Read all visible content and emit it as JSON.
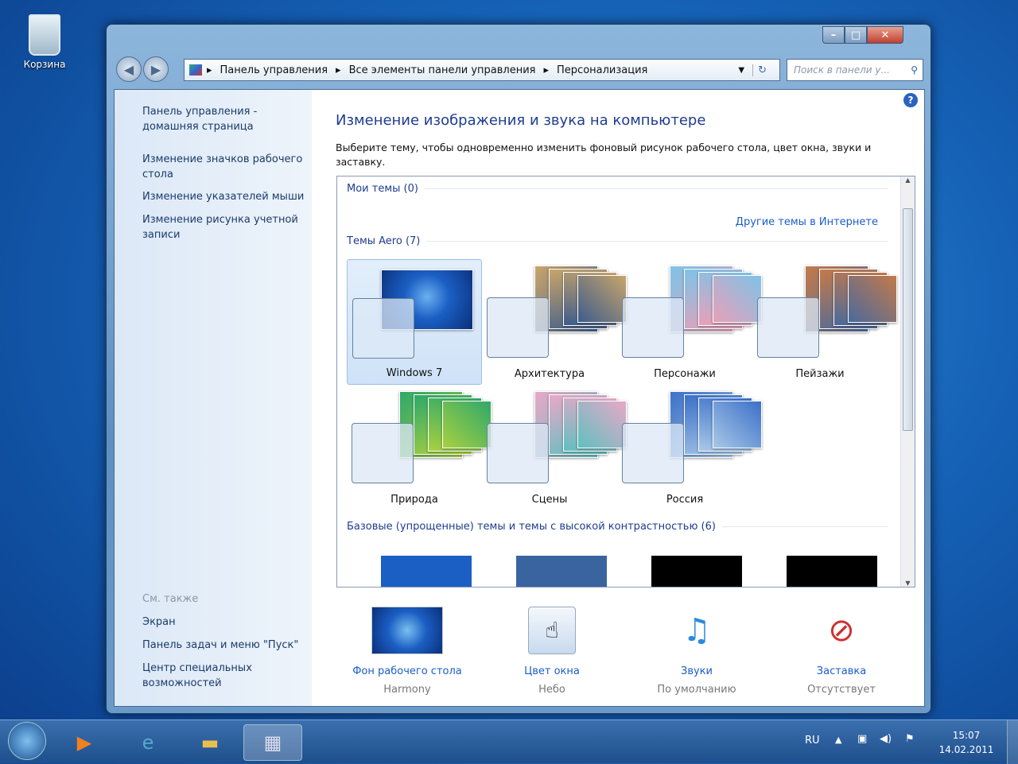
{
  "desktop": {
    "recycle_bin": "Корзина"
  },
  "window": {
    "controls": {
      "minimize": "–",
      "maximize": "□",
      "close": "✕"
    }
  },
  "address": {
    "crumbs": [
      "Панель управления",
      "Все элементы панели управления",
      "Персонализация"
    ],
    "search_placeholder": "Поиск в панели у..."
  },
  "left_pane": {
    "links": [
      "Панель управления - домашняя страница",
      "Изменение значков рабочего стола",
      "Изменение указателей мыши",
      "Изменение рисунка учетной записи"
    ],
    "see_also": "См. также",
    "see_also_links": [
      "Экран",
      "Панель задач и меню \"Пуск\"",
      "Центр специальных возможностей"
    ]
  },
  "main": {
    "title": "Изменение изображения и звука на компьютере",
    "description": "Выберите тему, чтобы одновременно изменить фоновый рисунок рабочего стола, цвет окна, звуки и заставку.",
    "my_themes": "Мои темы (0)",
    "more_themes": "Другие темы в Интернете",
    "aero_themes": "Темы Aero (7)",
    "themes": [
      {
        "name": "Windows 7",
        "c1": "#1b5fc4",
        "c2": "#0a2f7a"
      },
      {
        "name": "Архитектура",
        "c1": "#c9a56a",
        "c2": "#3d5c8c"
      },
      {
        "name": "Персонажи",
        "c1": "#7ec3e8",
        "c2": "#e8a0b8"
      },
      {
        "name": "Пейзажи",
        "c1": "#c47a4a",
        "c2": "#4a6a9c"
      },
      {
        "name": "Природа",
        "c1": "#2fa86a",
        "c2": "#a8d040"
      },
      {
        "name": "Сцены",
        "c1": "#e8a8c8",
        "c2": "#60c0c0"
      },
      {
        "name": "Россия",
        "c1": "#3c70c8",
        "c2": "#a8c8e8"
      }
    ],
    "basic_themes": "Базовые (упрощенные) темы и темы с высокой контрастностью (6)",
    "basic_colors": [
      "#1b5fc4",
      "#3a64a0",
      "#000000",
      "#000000"
    ]
  },
  "bottom": [
    {
      "label": "Фон рабочего стола",
      "value": "Harmony"
    },
    {
      "label": "Цвет окна",
      "value": "Небо"
    },
    {
      "label": "Звуки",
      "value": "По умолчанию"
    },
    {
      "label": "Заставка",
      "value": "Отсутствует"
    }
  ],
  "tray": {
    "lang": "RU",
    "time": "15:07",
    "date": "14.02.2011"
  }
}
